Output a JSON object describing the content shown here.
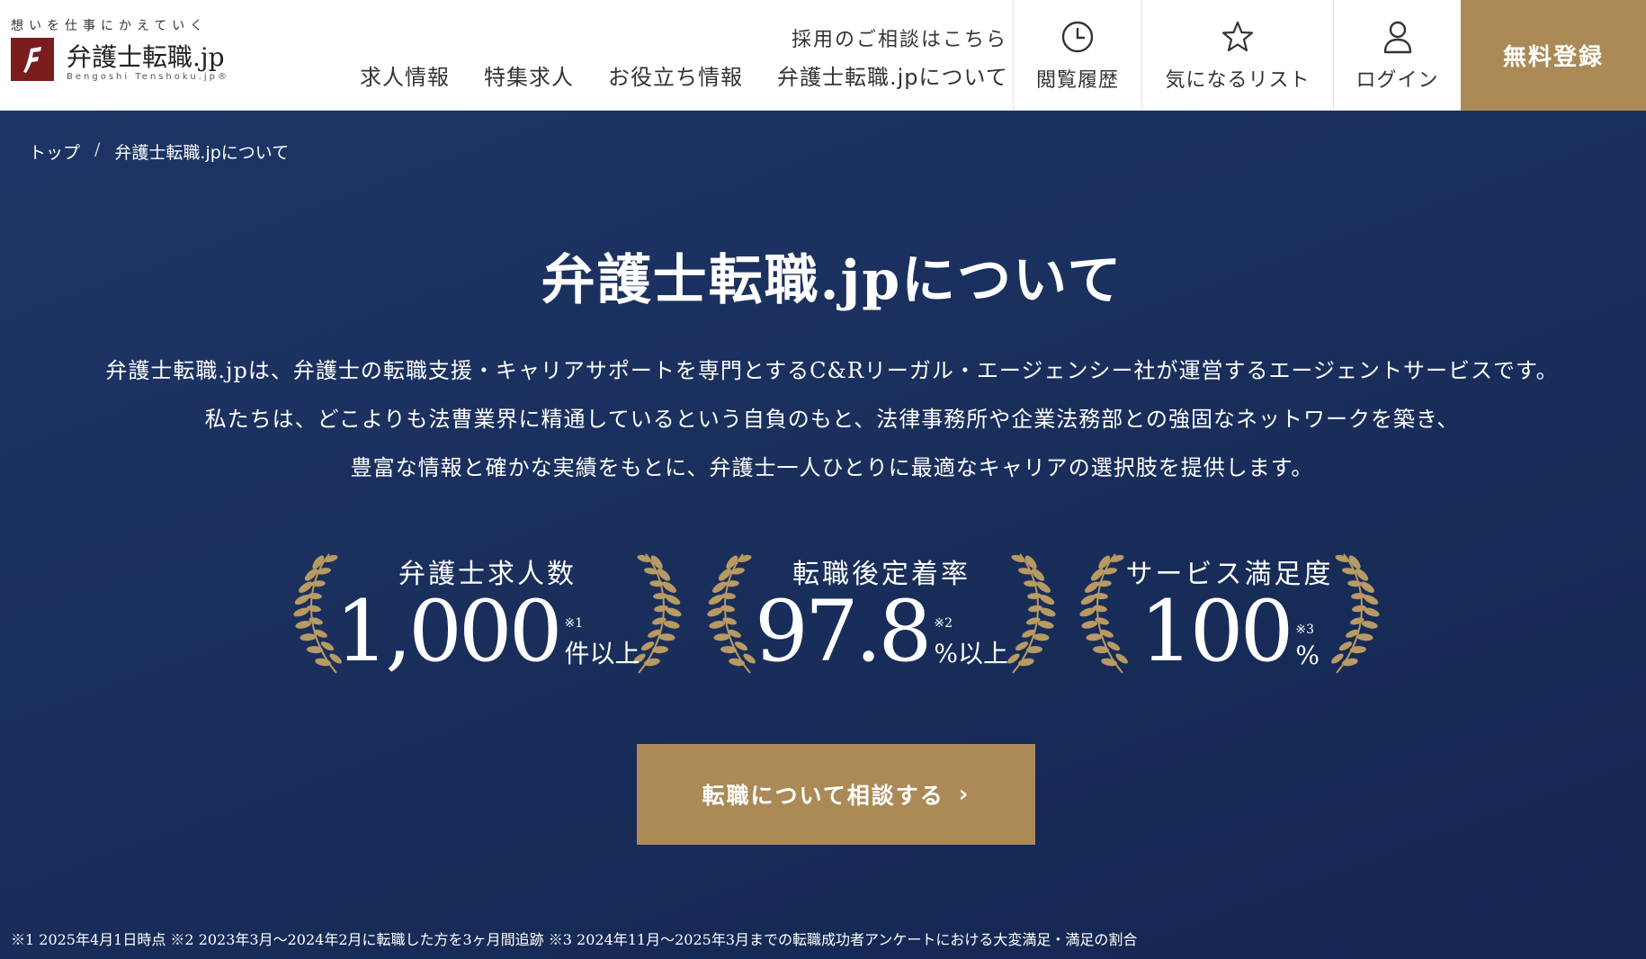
{
  "header": {
    "logo": {
      "tagline": "想いを仕事にかえていく",
      "name": "弁護士転職.jp",
      "roman": "Bengoshi Tenshoku.jp®"
    },
    "consult_link": "採用のご相談はこちら",
    "nav": [
      {
        "label": "求人情報"
      },
      {
        "label": "特集求人"
      },
      {
        "label": "お役立ち情報"
      },
      {
        "label": "弁護士転職.jpについて"
      }
    ],
    "buttons": {
      "history": {
        "label": "閲覧履歴",
        "icon": "clock-icon"
      },
      "favorites": {
        "label": "気になるリスト",
        "icon": "star-icon"
      },
      "login": {
        "label": "ログイン",
        "icon": "user-icon"
      }
    },
    "register_label": "無料登録"
  },
  "breadcrumb": [
    {
      "label": "トップ"
    },
    {
      "label": "弁護士転職.jpについて"
    }
  ],
  "breadcrumb_separator": "/",
  "hero": {
    "title": "弁護士転職.jpについて",
    "lead": [
      "弁護士転職.jpは、弁護士の転職支援・キャリアサポートを専門とするC&Rリーガル・エージェンシー社が運営するエージェントサービスです。",
      "私たちは、どこよりも法曹業界に精通しているという自負のもと、法律事務所や企業法務部との強固なネットワークを築き、",
      "豊富な情報と確かな実績をもとに、弁護士一人ひとりに最適なキャリアの選択肢を提供します。"
    ],
    "stats": [
      {
        "label": "弁護士求人数",
        "value": "1,000",
        "unit": "件以上",
        "note": "※1"
      },
      {
        "label": "転職後定着率",
        "value": "97.8",
        "unit": "%以上",
        "note": "※2"
      },
      {
        "label": "サービス満足度",
        "value": "100",
        "unit": "%",
        "note": "※3"
      }
    ],
    "cta_label": "転職について相談する",
    "cta_icon": "chevron-right-icon",
    "footnote": "※1 2025年4月1日時点 ※2 2023年3月～2024年2月に転職した方を3ヶ月間追跡 ※3 2024年11月～2025年3月までの転職成功者アンケートにおける大変満足・満足の割合"
  },
  "colors": {
    "brand_red": "#7a1c1e",
    "gold": "#ab8a57",
    "navy": "#1a2f5c",
    "laurel": "#b89a63"
  }
}
